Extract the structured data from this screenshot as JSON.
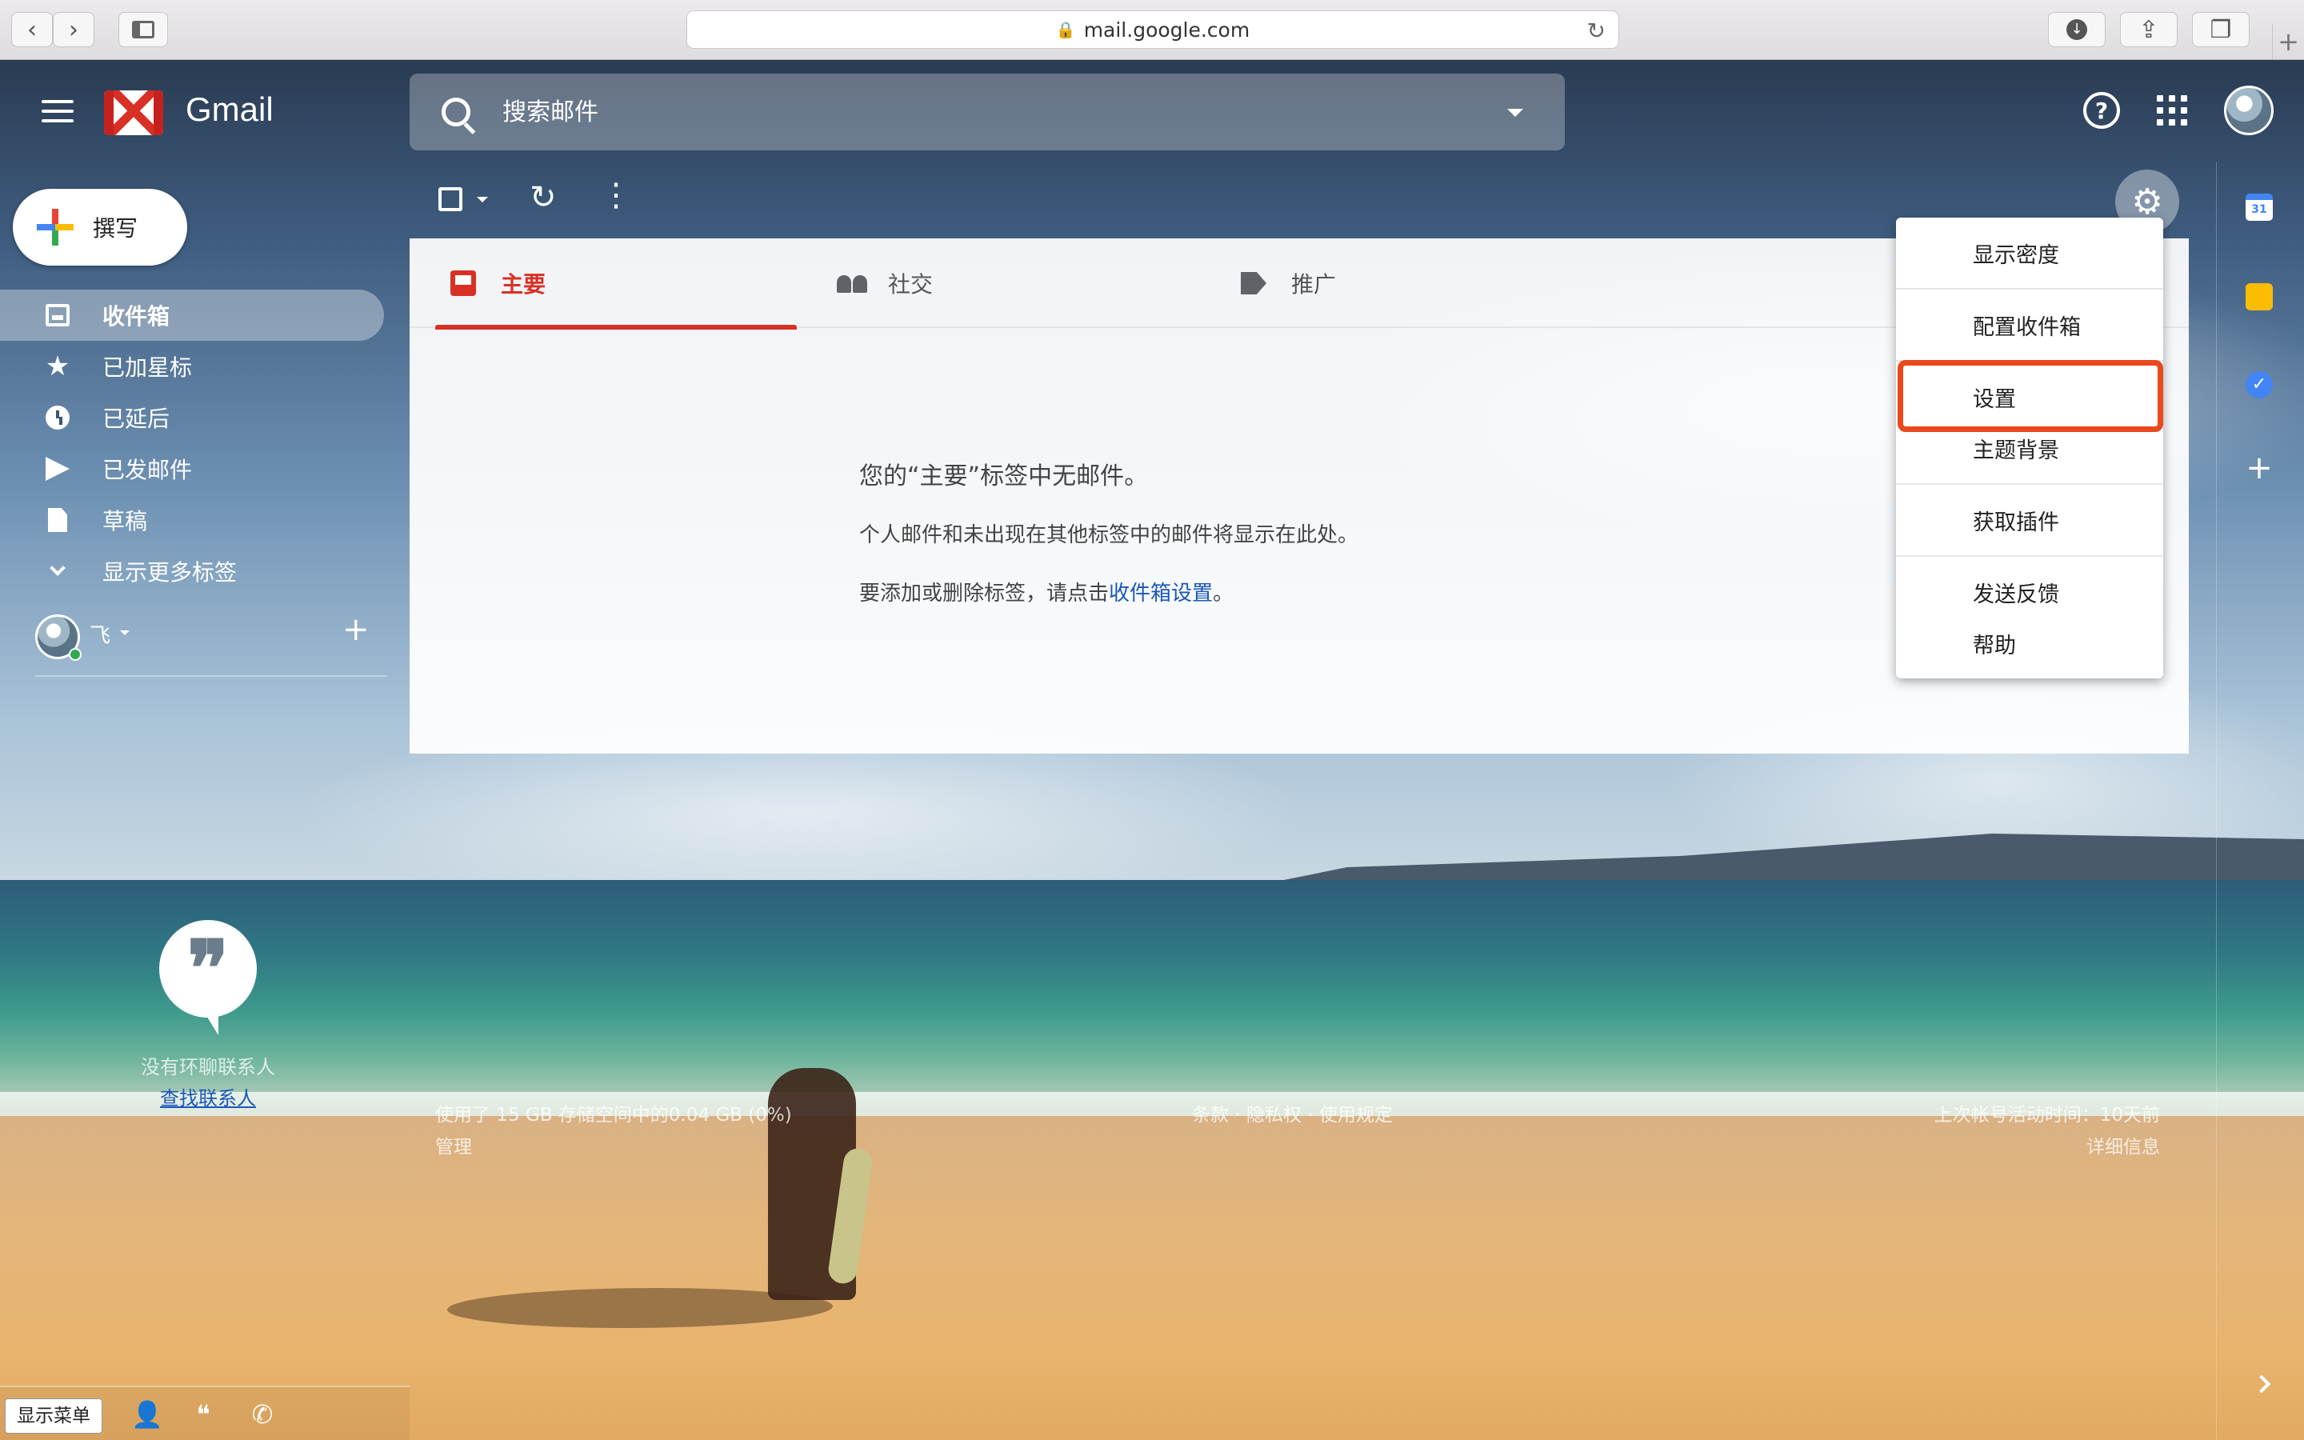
{
  "browser": {
    "url": "mail.google.com"
  },
  "header": {
    "app_name": "Gmail",
    "search_placeholder": "搜索邮件"
  },
  "sidebar": {
    "compose_label": "撰写",
    "items": [
      {
        "label": "收件箱",
        "icon": "inbox-icon",
        "active": true
      },
      {
        "label": "已加星标",
        "icon": "star-icon"
      },
      {
        "label": "已延后",
        "icon": "clock-icon"
      },
      {
        "label": "已发邮件",
        "icon": "send-icon"
      },
      {
        "label": "草稿",
        "icon": "draft-icon"
      },
      {
        "label": "显示更多标签",
        "icon": "chevron-down-icon"
      }
    ],
    "account_name": "飞",
    "hangouts_empty": "没有环聊联系人",
    "hangouts_link": "查找联系人"
  },
  "tabs": [
    {
      "label": "主要",
      "icon": "inbox-tab-icon",
      "active": true
    },
    {
      "label": "社交",
      "icon": "people-icon"
    },
    {
      "label": "推广",
      "icon": "tag-icon"
    }
  ],
  "empty_state": {
    "title": "您的“主要”标签中无邮件。",
    "line1": "个人邮件和未出现在其他标签中的邮件将显示在此处。",
    "line2_prefix": "要添加或删除标签，请点击",
    "line2_link": "收件箱设置",
    "line2_suffix": "。"
  },
  "footer": {
    "storage": "使用了 15 GB 存储空间中的0.04 GB (0%)",
    "manage": "管理",
    "links": "条款 · 隐私权 · 使用规定",
    "activity": "上次帐号活动时间：10天前",
    "details": "详细信息"
  },
  "settings_menu": {
    "items": [
      "显示密度",
      "配置收件箱",
      "设置",
      "主题背景",
      "获取插件",
      "发送反馈",
      "帮助"
    ],
    "highlighted": "设置"
  },
  "bottom_bar": {
    "show_menu": "显示菜单"
  },
  "side_panel": {
    "calendar_day": "31"
  },
  "colors": {
    "accent_red": "#d93025",
    "link_blue": "#1a57b8",
    "highlight_orange": "#e8491d"
  }
}
